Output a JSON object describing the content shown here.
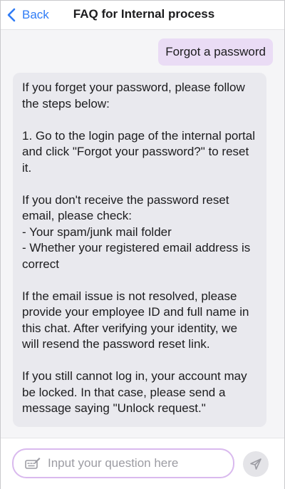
{
  "header": {
    "back_label": "Back",
    "title": "FAQ for Internal process"
  },
  "chat": {
    "user_message": "Forgot a password",
    "bot_paragraphs": [
      "If you forget your password, please follow the steps below:",
      "1. Go to the login page of the internal portal and click \"Forgot your password?\" to reset it.",
      "If you don't receive the password reset email, please check:",
      "- Your spam/junk mail folder",
      "- Whether your registered email address is correct",
      "If the email issue is not resolved, please provide your employee ID and full name in this chat. After verifying your identity, we will resend the password reset link.",
      "If you still cannot log in, your account may be locked. In that case, please send a message saying \"Unlock request.\""
    ]
  },
  "input": {
    "placeholder": "Input your question here"
  },
  "icons": {
    "back": "chevron-left-icon",
    "input": "keyboard-pencil-icon",
    "send": "send-icon"
  },
  "colors": {
    "accent": "#2f7cf6",
    "user_bubble": "#eadcf5",
    "bot_bubble": "#e9e9ee",
    "input_border": "#d9b9ee"
  }
}
